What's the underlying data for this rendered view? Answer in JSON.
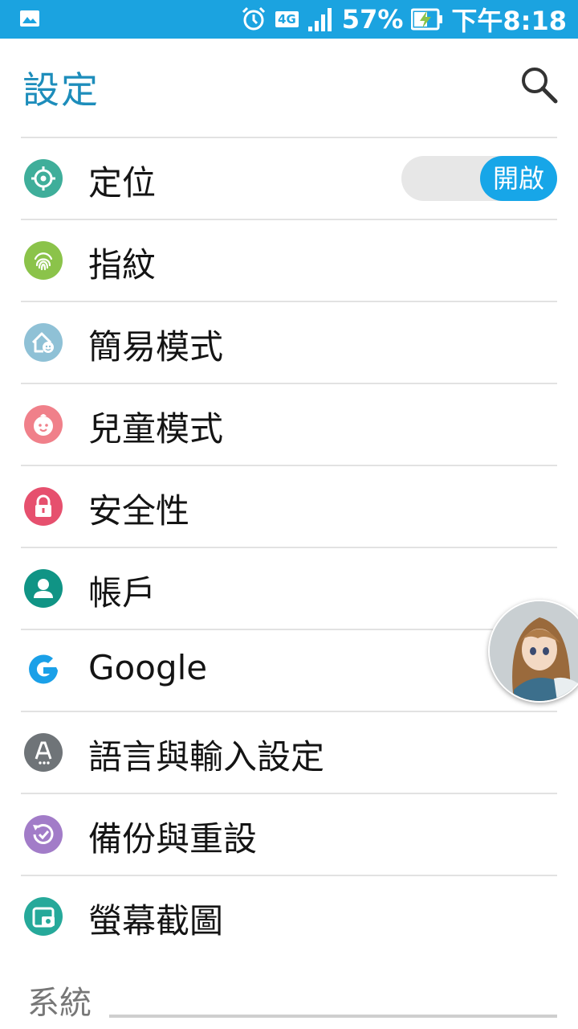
{
  "status_bar": {
    "network": "4G",
    "battery": "57%",
    "time": "下午8:18"
  },
  "header": {
    "title": "設定"
  },
  "settings": {
    "items": [
      {
        "label": "定位",
        "icon": "location-icon",
        "color": "#3fae9a"
      },
      {
        "label": "指紋",
        "icon": "fingerprint-icon",
        "color": "#8bc34a"
      },
      {
        "label": "簡易模式",
        "icon": "easy-mode-icon",
        "color": "#8fc1d6"
      },
      {
        "label": "兒童模式",
        "icon": "kids-mode-icon",
        "color": "#f0808a"
      },
      {
        "label": "安全性",
        "icon": "lock-icon",
        "color": "#e6506e"
      },
      {
        "label": "帳戶",
        "icon": "account-icon",
        "color": "#109485"
      },
      {
        "label": "Google",
        "icon": "google-icon",
        "color": "#1aa0e8"
      },
      {
        "label": "語言與輸入設定",
        "icon": "language-icon",
        "color": "#6f7478"
      },
      {
        "label": "備份與重設",
        "icon": "backup-icon",
        "color": "#a27cc8"
      },
      {
        "label": "螢幕截圖",
        "icon": "screenshot-icon",
        "color": "#26a99a"
      }
    ],
    "location_toggle": "開啟"
  },
  "section": {
    "title": "系統"
  },
  "colors": {
    "accent": "#1ba3e0",
    "title": "#1d8dbb"
  }
}
